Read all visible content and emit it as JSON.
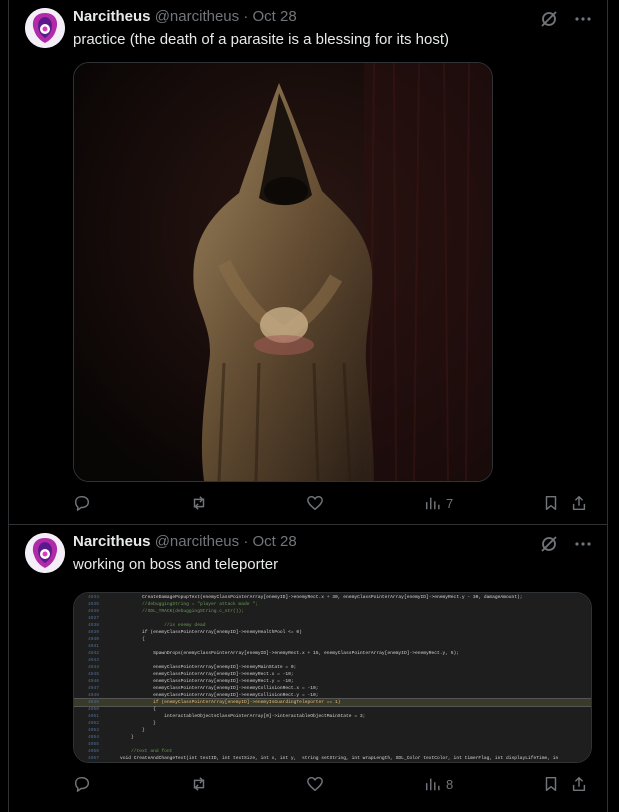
{
  "tweets": [
    {
      "name": "Narcitheus",
      "handle": "@narcitheus",
      "dot": "·",
      "date": "Oct 28",
      "text": "practice (the death of a parasite is a blessing for its host)",
      "views": "7"
    },
    {
      "name": "Narcitheus",
      "handle": "@narcitheus",
      "dot": "·",
      "date": "Oct 28",
      "text": "working on boss and teleporter",
      "views": "8"
    }
  ],
  "code_lines": [
    {
      "n": "4934",
      "t": "        CreateDamagePopupText(enemyClassPointerArray[enemyID]->enemyRect.x + 30, enemyClassPointerArray[enemyID]->enemyRect.y - 30, damageAmount);"
    },
    {
      "n": "4935",
      "t": "        //debuggingString = \"player attack made \";"
    },
    {
      "n": "4936",
      "t": "        //SDL_TRACK(debuggingString.c_str());"
    },
    {
      "n": "4937",
      "t": ""
    },
    {
      "n": "4938",
      "t": "                //is enemy dead"
    },
    {
      "n": "4939",
      "t": "        if (enemyClassPointerArray[enemyID]->enemyHealthPool <= 0)"
    },
    {
      "n": "4940",
      "t": "        {"
    },
    {
      "n": "4941",
      "t": ""
    },
    {
      "n": "4942",
      "t": "            SpawnDrops(enemyClassPointerArray[enemyID]->enemyRect.x + 15, enemyClassPointerArray[enemyID]->enemyRect.y, 5);"
    },
    {
      "n": "4943",
      "t": ""
    },
    {
      "n": "4944",
      "t": "            enemyClassPointerArray[enemyID]->enemyMainState = 0;"
    },
    {
      "n": "4945",
      "t": "            enemyClassPointerArray[enemyID]->enemyRect.x = -10;"
    },
    {
      "n": "4946",
      "t": "            enemyClassPointerArray[enemyID]->enemyRect.y = -10;"
    },
    {
      "n": "4947",
      "t": "            enemyClassPointerArray[enemyID]->enemyCollisionRect.x = -10;"
    },
    {
      "n": "4948",
      "t": "            enemyClassPointerArray[enemyID]->enemyCollisionRect.y = -10;"
    },
    {
      "n": "4949",
      "t": "            if (enemyClassPointerArray[enemyID]->enemyIsGuardingTeleporter == 1)"
    },
    {
      "n": "4950",
      "t": "            {"
    },
    {
      "n": "4951",
      "t": "                interactableObjectsClassPointerArray[0]->interactableObjectMainState = 3;"
    },
    {
      "n": "4952",
      "t": "            }"
    },
    {
      "n": "4953",
      "t": "        }"
    },
    {
      "n": "4954",
      "t": "    }"
    },
    {
      "n": "4955",
      "t": ""
    },
    {
      "n": "4956",
      "t": "    //text and font"
    },
    {
      "n": "4957",
      "t": "void CreateAndChangeText(int textID, int textSize, int x, int y,  string setString, int wrapLength, SDL_Color textColor, int timerFlag, int displayLifeTime, in"
    }
  ]
}
